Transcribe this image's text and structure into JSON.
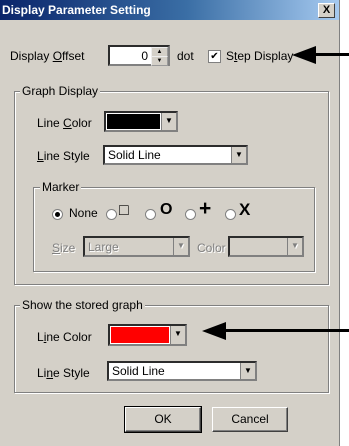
{
  "window": {
    "title": "Display Parameter Setting",
    "close_glyph": "X"
  },
  "display_offset": {
    "label_pre": "Display ",
    "label_key": "O",
    "label_post": "ffset",
    "value": "0",
    "unit": "dot"
  },
  "step_display": {
    "label_pre": "S",
    "label_key": "t",
    "label_post": "ep Display",
    "checked": true
  },
  "graph_display": {
    "title": "Graph Display",
    "line_color": {
      "label_pre": "Line ",
      "label_key": "C",
      "label_post": "olor",
      "color": "#000000"
    },
    "line_style": {
      "label_key": "L",
      "label_post": "ine Style",
      "value": "Solid Line"
    },
    "marker": {
      "title": "Marker",
      "options": [
        {
          "label": "None",
          "symbol": "",
          "selected": true
        },
        {
          "label": "",
          "symbol": "□",
          "selected": false
        },
        {
          "label": "",
          "symbol": "O",
          "selected": false
        },
        {
          "label": "",
          "symbol": "+",
          "selected": false
        },
        {
          "label": "",
          "symbol": "X",
          "selected": false
        }
      ],
      "size": {
        "label_key": "S",
        "label_post": "ize",
        "value": "Large"
      },
      "color": {
        "label": "Color",
        "value": ""
      }
    }
  },
  "stored_graph": {
    "title": "Show the stored graph",
    "line_color": {
      "label_pre": "L",
      "label_key": "i",
      "label_post": "ne Color",
      "color": "#ff0000"
    },
    "line_style": {
      "label_pre": "Li",
      "label_key": "n",
      "label_post": "e Style",
      "value": "Solid Line"
    }
  },
  "buttons": {
    "ok": "OK",
    "cancel": "Cancel"
  }
}
